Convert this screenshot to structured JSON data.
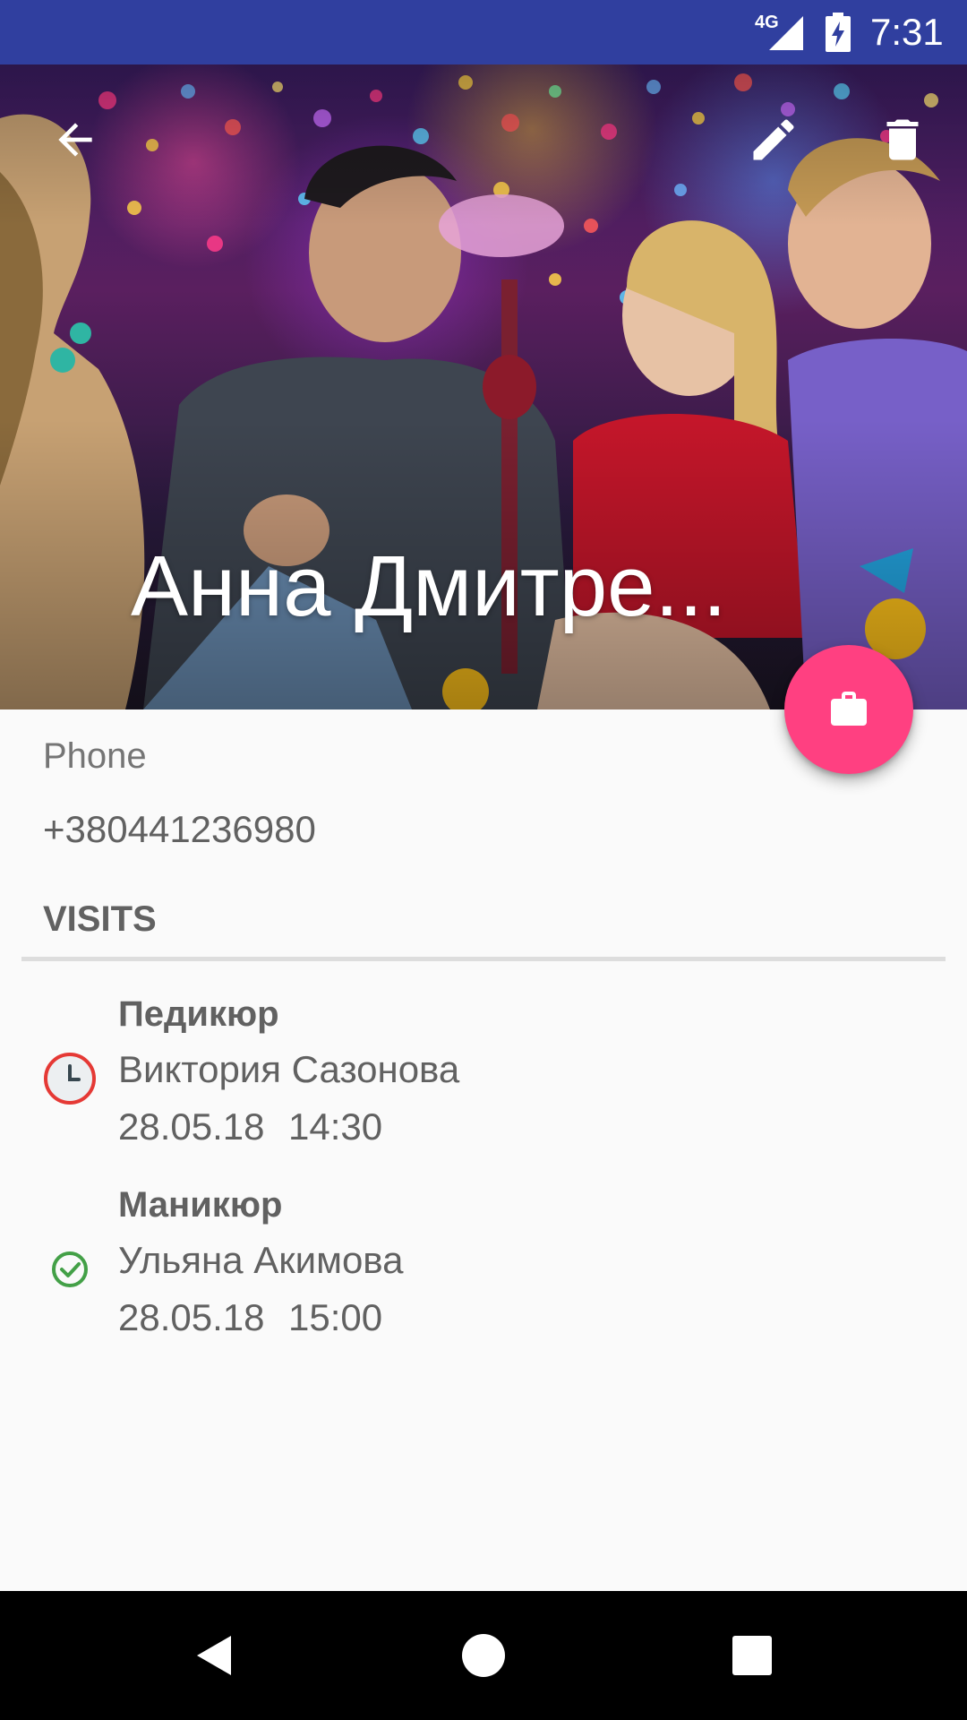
{
  "status_bar": {
    "network": "4G",
    "time": "7:31"
  },
  "header": {
    "contact_name": "Анна Дмитре...",
    "back_icon": "arrow-back-icon",
    "edit_icon": "pencil-icon",
    "delete_icon": "trash-icon"
  },
  "fab": {
    "icon": "briefcase-icon",
    "color": "#ff4081"
  },
  "contact": {
    "phone_label": "Phone",
    "phone_value": "+380441236980"
  },
  "visits": {
    "header": "VISITS",
    "items": [
      {
        "service": "Педикюр",
        "master": "Виктория Сазонова",
        "date": "28.05.18",
        "time": "14:30",
        "status_icon": "clock-icon",
        "status_color": "#e53935"
      },
      {
        "service": "Маникюр",
        "master": "Ульяна Акимова",
        "date": "28.05.18",
        "time": "15:00",
        "status_icon": "check-circle-icon",
        "status_color": "#43a047"
      }
    ]
  },
  "colors": {
    "status_bar": "#303f9f",
    "background": "#fafafa",
    "text_secondary": "#616161"
  }
}
